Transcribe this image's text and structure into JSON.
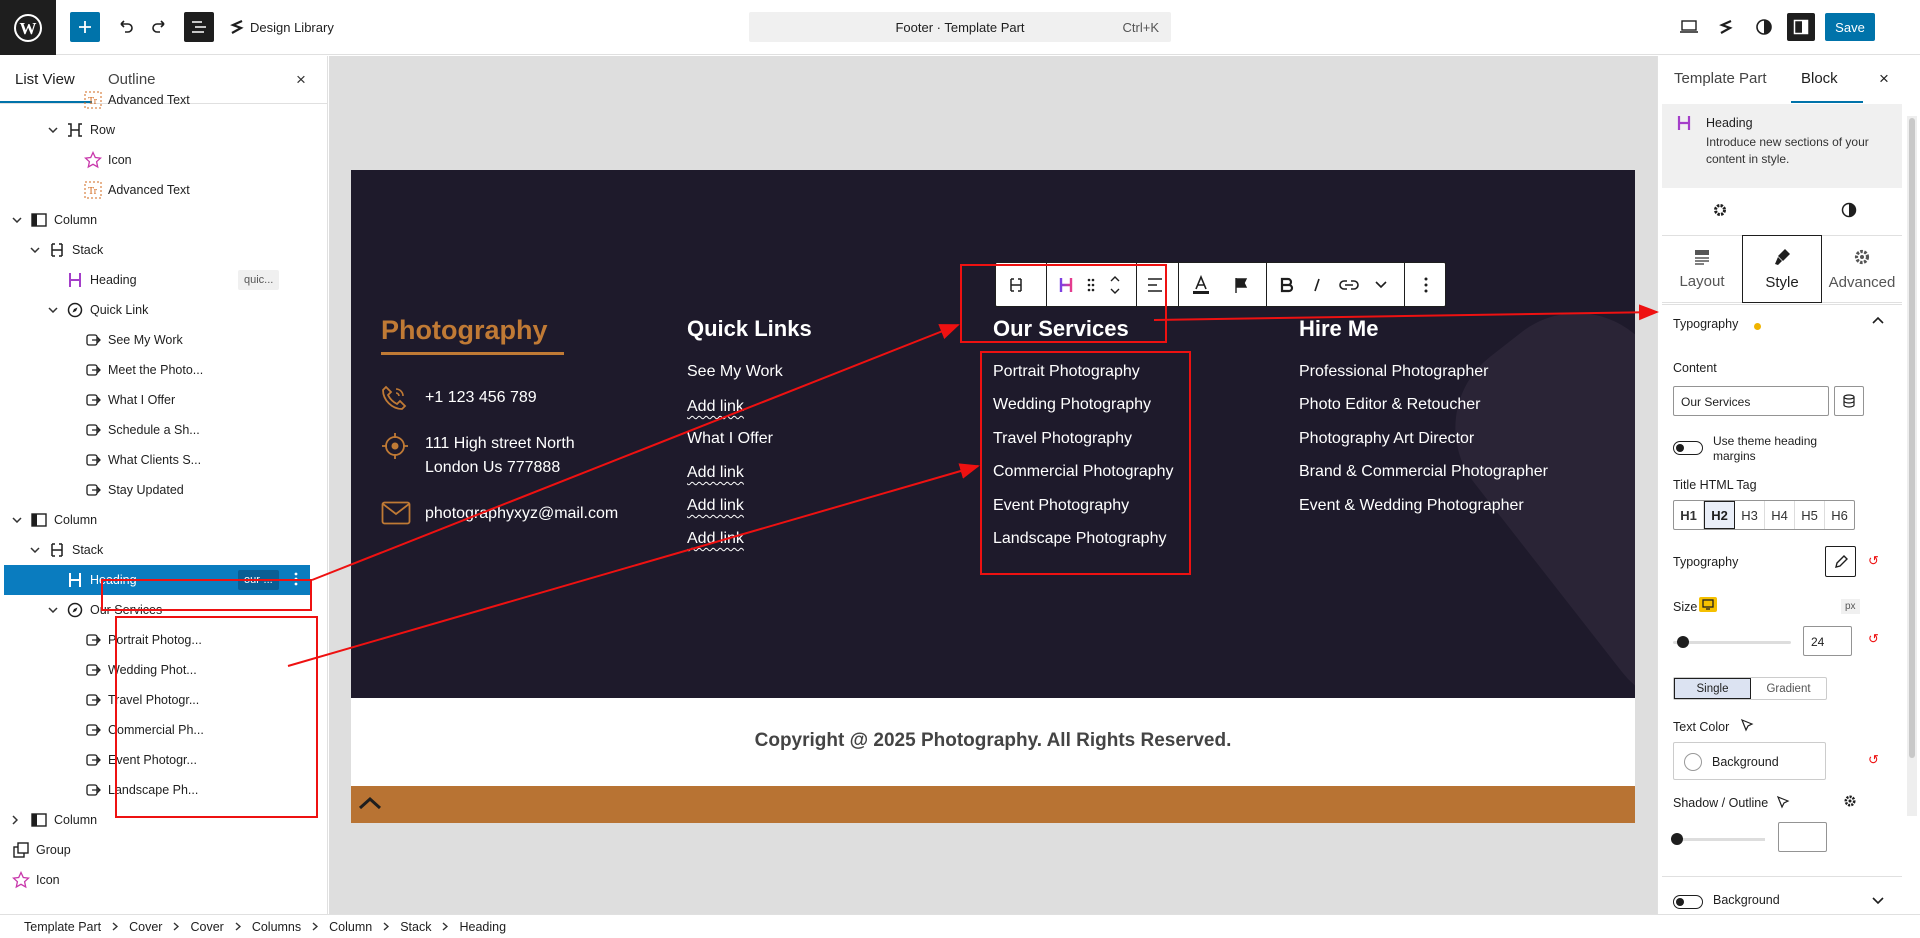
{
  "topbar": {
    "design_library": "Design Library",
    "doc_title": "Footer · Template Part",
    "shortcut": "Ctrl+K",
    "save": "Save"
  },
  "left_panel": {
    "tab_list": "List View",
    "tab_outline": "Outline",
    "close": "×",
    "rows": [
      {
        "label": "Advanced Text",
        "icon": "advanced-text-icon"
      },
      {
        "label": "Row",
        "icon": "row-icon"
      },
      {
        "label": "Icon",
        "icon": "star-icon"
      },
      {
        "label": "Advanced Text",
        "icon": "advanced-text-icon"
      },
      {
        "label": "Column",
        "icon": "column-icon"
      },
      {
        "label": "Stack",
        "icon": "stack-icon"
      },
      {
        "label": "Heading",
        "icon": "heading-icon",
        "badge": "quic..."
      },
      {
        "label": "Quick Link",
        "icon": "compass-icon"
      },
      {
        "label": "See My Work",
        "icon": "link-icon"
      },
      {
        "label": "Meet the Photo...",
        "icon": "link-icon"
      },
      {
        "label": "What I Offer",
        "icon": "link-icon"
      },
      {
        "label": "Schedule a Sh...",
        "icon": "link-icon"
      },
      {
        "label": "What Clients S...",
        "icon": "link-icon"
      },
      {
        "label": "Stay Updated",
        "icon": "link-icon"
      },
      {
        "label": "Column",
        "icon": "column-icon"
      },
      {
        "label": "Stack",
        "icon": "stack-icon"
      },
      {
        "label": "Heading",
        "icon": "heading-icon",
        "badge": "our-..."
      },
      {
        "label": "Our Services",
        "icon": "compass-icon"
      },
      {
        "label": "Portrait Photog...",
        "icon": "link-icon"
      },
      {
        "label": "Wedding Phot...",
        "icon": "link-icon"
      },
      {
        "label": "Travel Photogr...",
        "icon": "link-icon"
      },
      {
        "label": "Commercial Ph...",
        "icon": "link-icon"
      },
      {
        "label": "Event Photogr...",
        "icon": "link-icon"
      },
      {
        "label": "Landscape Ph...",
        "icon": "link-icon"
      },
      {
        "label": "Column",
        "icon": "column-icon"
      },
      {
        "label": "Group",
        "icon": "group-icon"
      },
      {
        "label": "Icon",
        "icon": "star-icon"
      }
    ]
  },
  "footer": {
    "brand": "Photography",
    "phone": "+1 123 456 789",
    "address_line1": "111 High street North",
    "address_line2": "London Us 777888",
    "email": "photographyxyz@mail.com",
    "quick_links_title": "Quick Links",
    "quick_links": [
      "See My Work",
      "Add link",
      "What I Offer",
      "Add link",
      "Add link",
      "Add link"
    ],
    "services_title": "Our Services",
    "services": [
      "Portrait Photography",
      "Wedding Photography",
      "Travel Photography",
      "Commercial Photography",
      "Event Photography",
      "Landscape Photography"
    ],
    "hire_title": "Hire Me",
    "hire": [
      "Professional Photographer",
      "Photo Editor & Retoucher",
      "Photography Art Director",
      "Brand & Commercial Photographer",
      "Event & Wedding Photographer"
    ],
    "copyright": "Copyright @ 2025 Photography. All Rights Reserved."
  },
  "right_panel": {
    "tab_template": "Template Part",
    "tab_block": "Block",
    "close": "×",
    "block_name": "Heading",
    "block_desc": "Introduce new sections of your content in style.",
    "subtabs": [
      "Layout",
      "Style",
      "Advanced"
    ],
    "section_typography": "Typography",
    "content_label": "Content",
    "content_value": "Our Services",
    "theme_margins": "Use theme heading margins",
    "title_tag_label": "Title HTML Tag",
    "tags": [
      "H1",
      "H2",
      "H3",
      "H4",
      "H5",
      "H6"
    ],
    "typography_label": "Typography",
    "size_label": "Size",
    "size_unit": "px",
    "size_value": "24",
    "single": "Single",
    "gradient": "Gradient",
    "text_color": "Text Color",
    "background": "Background",
    "shadow": "Shadow / Outline",
    "bg_section": "Background"
  },
  "breadcrumb": [
    "Template Part",
    "Cover",
    "Cover",
    "Columns",
    "Column",
    "Stack",
    "Heading"
  ],
  "colors": {
    "accent": "#0073aa",
    "footer_bg": "#1e1a2b",
    "brand_orange": "#c07a35",
    "annotation_red": "#ee1111"
  }
}
